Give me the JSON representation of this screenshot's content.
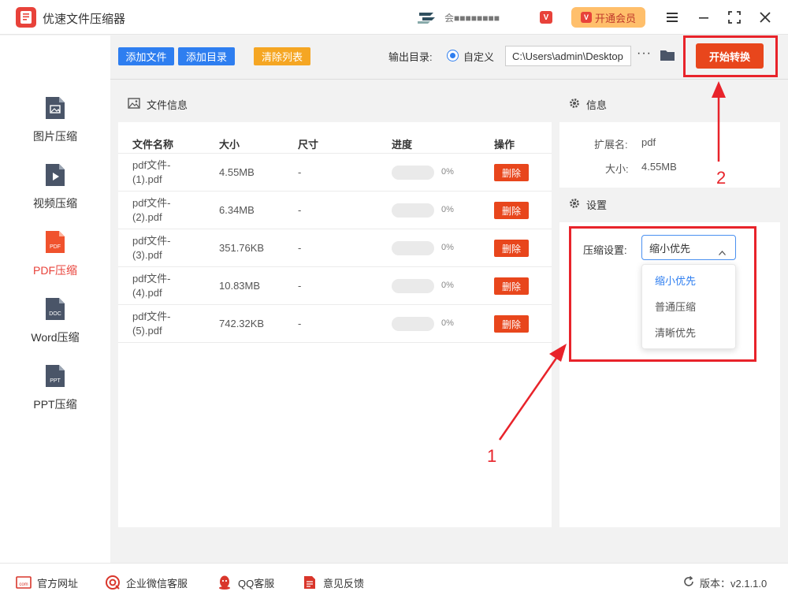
{
  "app": {
    "title": "优速文件压缩器",
    "user_name": "会■■■■■■■■",
    "vip_badge": "V",
    "vip_button_label": "开通会员"
  },
  "sidebar": {
    "items": [
      {
        "label": "图片压缩",
        "icon": "image-file-icon",
        "file_tag": ""
      },
      {
        "label": "视频压缩",
        "icon": "video-file-icon",
        "file_tag": ""
      },
      {
        "label": "PDF压缩",
        "icon": "pdf-file-icon",
        "file_tag": "PDF",
        "active": true
      },
      {
        "label": "Word压缩",
        "icon": "word-file-icon",
        "file_tag": "DOC"
      },
      {
        "label": "PPT压缩",
        "icon": "ppt-file-icon",
        "file_tag": "PPT"
      }
    ]
  },
  "toolbar": {
    "add_file": "添加文件",
    "add_dir": "添加目录",
    "clear_list": "清除列表",
    "output_label": "输出目录:",
    "custom_label": "自定义",
    "path_value": "C:\\Users\\admin\\Desktop",
    "more": "···",
    "start_label": "开始转换"
  },
  "file_panel": {
    "title": "文件信息",
    "columns": [
      "文件名称",
      "大小",
      "尺寸",
      "进度",
      "操作"
    ],
    "rows": [
      {
        "name": "pdf文件-(1).pdf",
        "size": "4.55MB",
        "dim": "-",
        "progress": "0%",
        "action": "删除"
      },
      {
        "name": "pdf文件-(2).pdf",
        "size": "6.34MB",
        "dim": "-",
        "progress": "0%",
        "action": "删除"
      },
      {
        "name": "pdf文件-(3).pdf",
        "size": "351.76KB",
        "dim": "-",
        "progress": "0%",
        "action": "删除"
      },
      {
        "name": "pdf文件-(4).pdf",
        "size": "10.83MB",
        "dim": "-",
        "progress": "0%",
        "action": "删除"
      },
      {
        "name": "pdf文件-(5).pdf",
        "size": "742.32KB",
        "dim": "-",
        "progress": "0%",
        "action": "删除"
      }
    ]
  },
  "info_panel": {
    "title": "信息",
    "ext_label": "扩展名:",
    "ext_value": "pdf",
    "size_label": "大小:",
    "size_value": "4.55MB",
    "settings_title": "设置",
    "compress_label": "压缩设置:",
    "compress_value": "缩小优先",
    "options": [
      "缩小优先",
      "普通压缩",
      "清晰优先"
    ]
  },
  "footer": {
    "website": "官方网址",
    "wechat": "企业微信客服",
    "qq": "QQ客服",
    "feedback": "意见反馈",
    "version": "版本：v2.1.1.0"
  },
  "annotations": {
    "one": "1",
    "two": "2"
  },
  "colors": {
    "accent": "#e8461c",
    "blue": "#2e7ef0",
    "orange": "#f5a623",
    "annotation": "#e8232a"
  }
}
